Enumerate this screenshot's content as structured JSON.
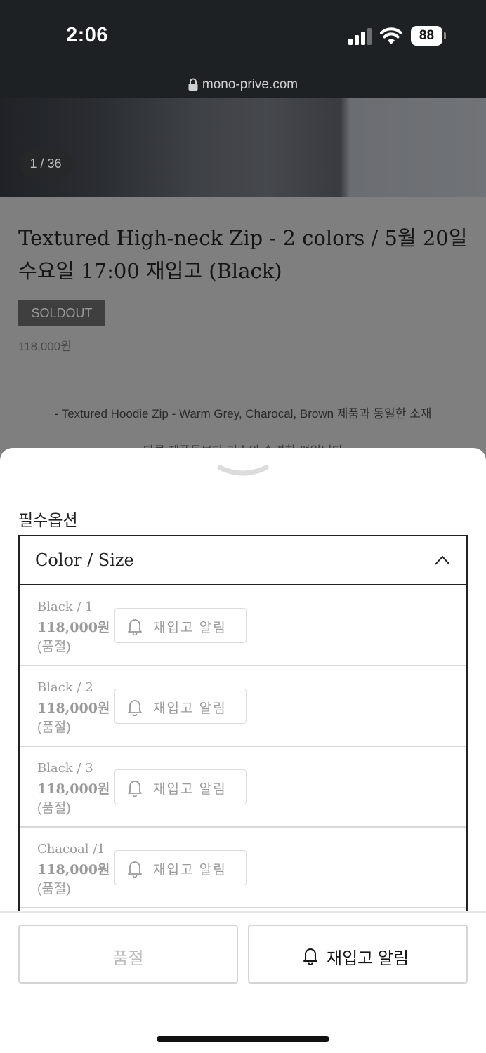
{
  "status_bar": {
    "time": "2:06",
    "battery": "88"
  },
  "browser": {
    "url": "mono-prive.com"
  },
  "product": {
    "image_counter": "1 / 36",
    "title": "Textured High-neck Zip - 2 colors / 5월 20일 수요일 17:00 재입고 (Black)",
    "badge": "SOLDOUT",
    "price": "118,000원",
    "description_line1": "- Textured Hoodie Zip - Warm Grey, Charocal, Brown 제품과 동일한 소재",
    "description_line2": "다른 제품들보다 기수의 숙련한 편입니다"
  },
  "sheet": {
    "section_label": "필수옵션",
    "select_label": "Color / Size",
    "options": [
      {
        "name": "Black / 1",
        "price": "118,000원",
        "status": "(품절)",
        "restock_label": "재입고 알림"
      },
      {
        "name": "Black / 2",
        "price": "118,000원",
        "status": "(품절)",
        "restock_label": "재입고 알림"
      },
      {
        "name": "Black / 3",
        "price": "118,000원",
        "status": "(품절)",
        "restock_label": "재입고 알림"
      },
      {
        "name": "Chacoal /1",
        "price": "118,000원",
        "status": "(품절)",
        "restock_label": "재입고 알림"
      }
    ],
    "soldout_button": "품절",
    "restock_button": "재입고 알림"
  }
}
